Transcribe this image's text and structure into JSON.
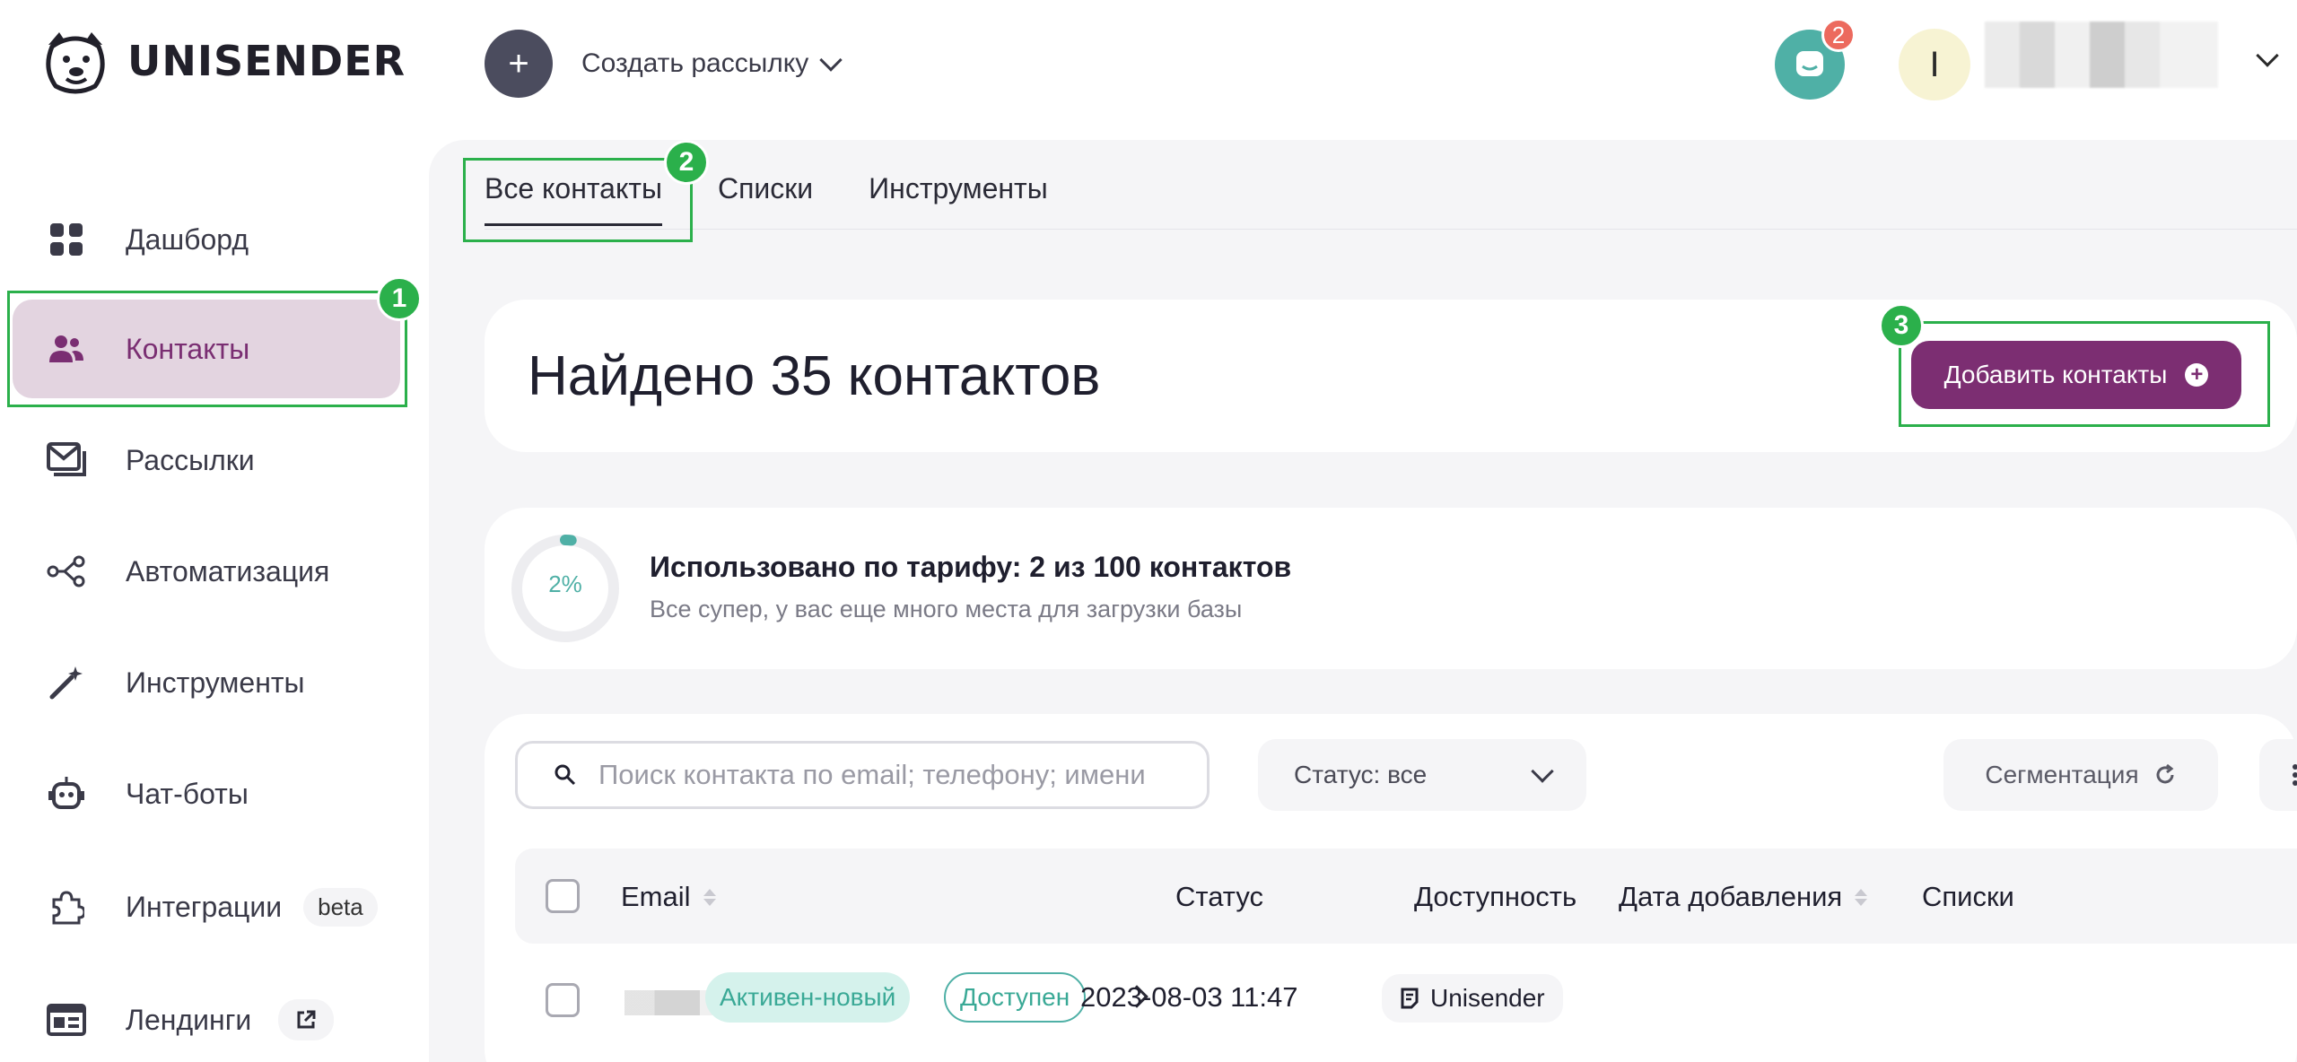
{
  "header": {
    "logo_text": "UNISENDER",
    "create_button_icon": "+",
    "create_label": "Создать рассылку",
    "notification_count": "2",
    "user_initial": "I"
  },
  "sidebar": {
    "items": [
      {
        "label": "Дашборд",
        "icon": "dashboard-icon"
      },
      {
        "label": "Контакты",
        "icon": "contacts-icon",
        "active": true
      },
      {
        "label": "Рассылки",
        "icon": "mail-icon"
      },
      {
        "label": "Автоматизация",
        "icon": "automation-icon"
      },
      {
        "label": "Инструменты",
        "icon": "magic-wand-icon"
      },
      {
        "label": "Чат-боты",
        "icon": "robot-icon"
      },
      {
        "label": "Интеграции",
        "icon": "puzzle-icon",
        "pill": "beta"
      },
      {
        "label": "Лендинги",
        "icon": "landing-icon",
        "pill_icon": "external-link-icon"
      }
    ]
  },
  "annotations": {
    "one": "1",
    "two": "2",
    "three": "3"
  },
  "tabs": [
    {
      "label": "Все контакты",
      "active": true
    },
    {
      "label": "Списки"
    },
    {
      "label": "Инструменты"
    }
  ],
  "summary": {
    "title": "Найдено 35 контактов",
    "add_button": "Добавить контакты"
  },
  "usage": {
    "percent_label": "2%",
    "percent_value": 0.02,
    "title": "Использовано по тарифу: 2 из 100 контактов",
    "subtitle": "Все супер, у вас еще много места для загрузки базы"
  },
  "filters": {
    "search_placeholder": "Поиск контакта по email; телефону; имени",
    "status_label": "Статус: все",
    "segmentation_label": "Сегментация"
  },
  "table": {
    "columns": [
      "Email",
      "Статус",
      "Доступность",
      "Дата добавления",
      "Списки"
    ],
    "rows": [
      {
        "status": "Активен-новый",
        "availability": "Доступен",
        "date": "2023-08-03 11:47",
        "list": "Unisender"
      }
    ]
  },
  "colors": {
    "accent": "#7c2e72",
    "teal": "#4fb0a6",
    "highlight": "#2bb04b"
  }
}
